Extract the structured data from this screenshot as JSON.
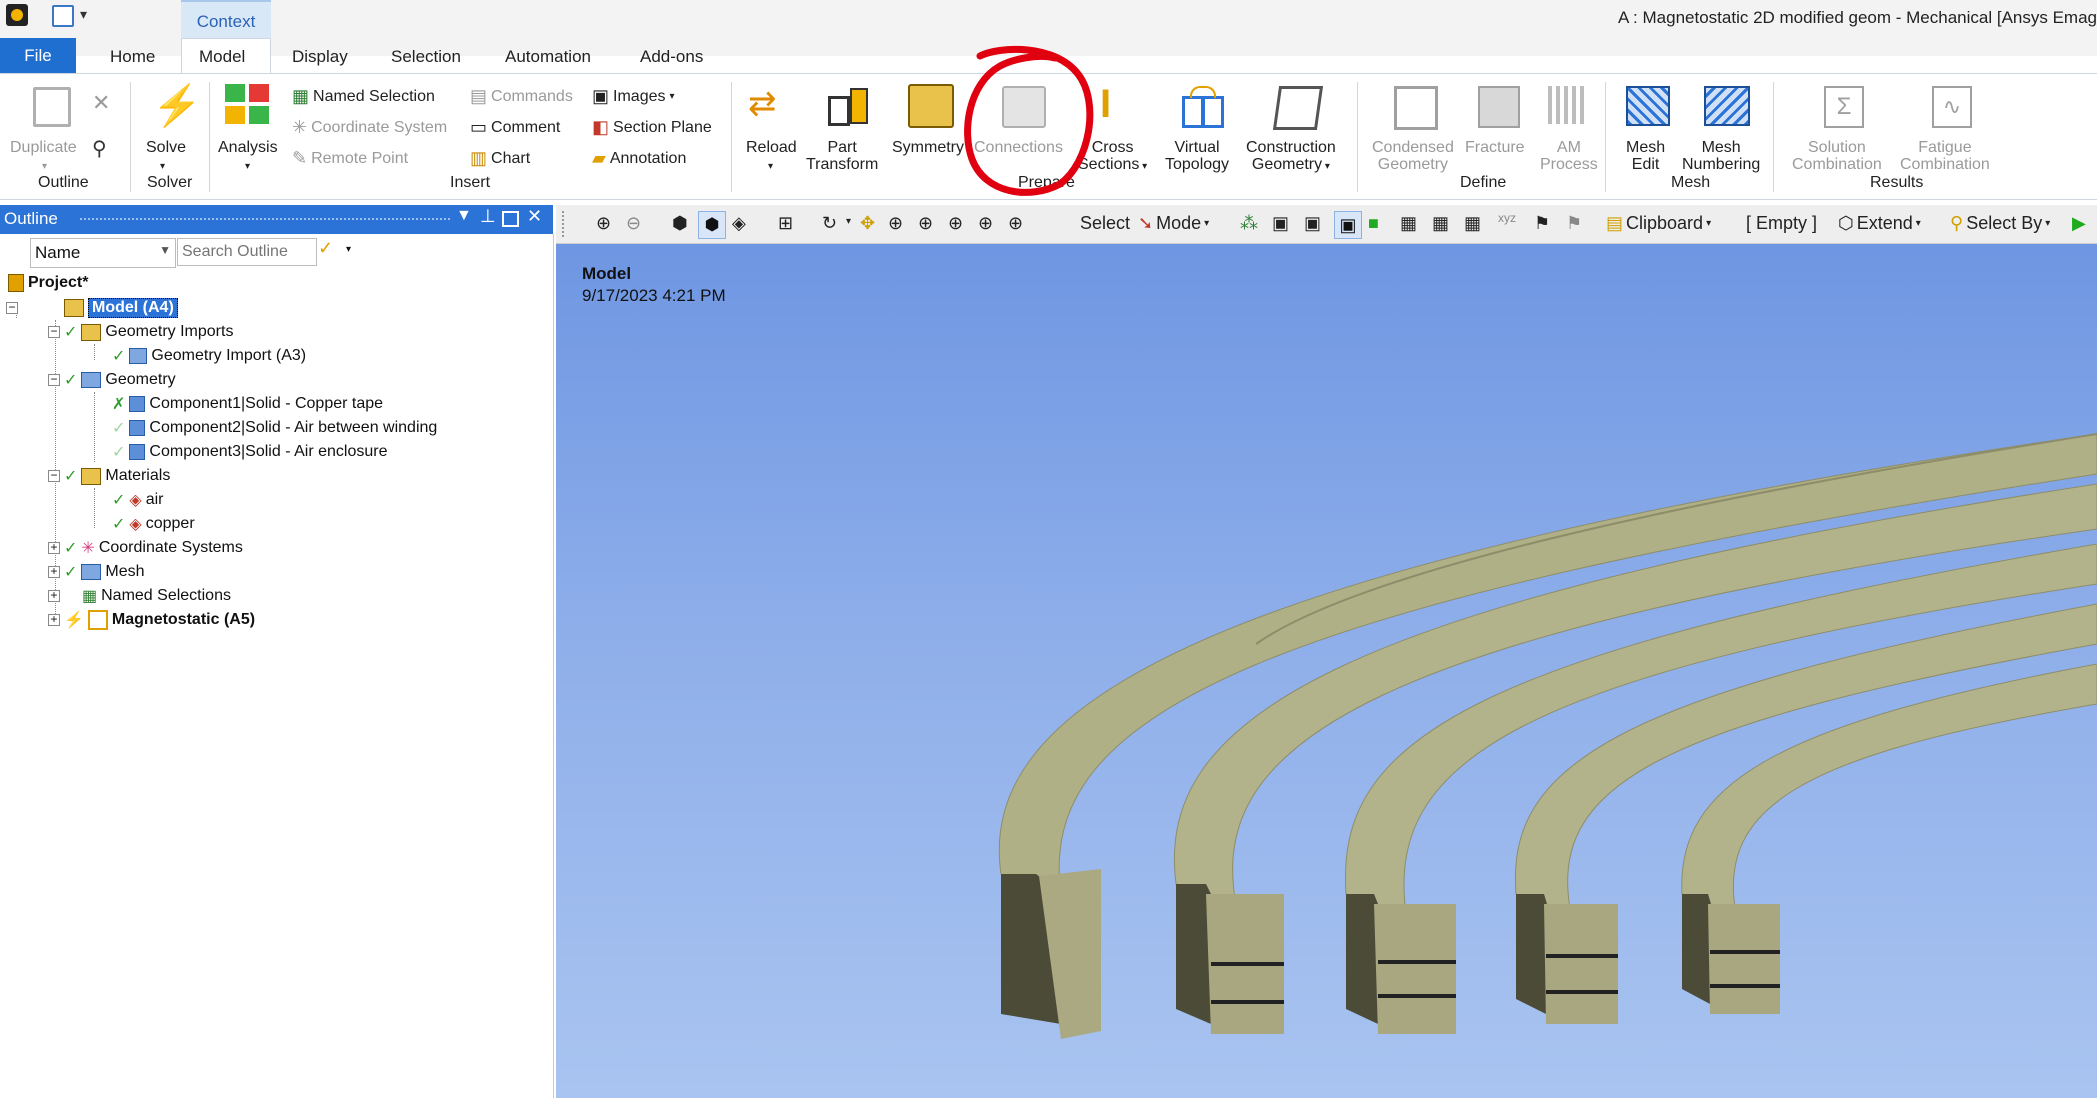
{
  "titlebar": {
    "context_tab": "Context",
    "window_title": "A : Magnetostatic 2D modified geom - Mechanical [Ansys Emag"
  },
  "tabs": [
    "File",
    "Home",
    "Model",
    "Display",
    "Selection",
    "Automation",
    "Add-ons"
  ],
  "ribbon": {
    "outline": {
      "duplicate": "Duplicate",
      "group": "Outline"
    },
    "solver": {
      "solve": "Solve",
      "group": "Solver"
    },
    "insert": {
      "analysis": "Analysis",
      "named_selection": "Named Selection",
      "coordinate_system": "Coordinate System",
      "remote_point": "Remote Point",
      "commands": "Commands",
      "comment": "Comment",
      "chart": "Chart",
      "images": "Images",
      "section_plane": "Section Plane",
      "annotation": "Annotation",
      "group": "Insert"
    },
    "prepare": {
      "reload": "Reload",
      "part_transform_1": "Part",
      "part_transform_2": "Transform",
      "symmetry": "Symmetry",
      "connections": "Connections",
      "cross_sections_1": "Cross",
      "cross_sections_2": "Sections",
      "virtual_topology_1": "Virtual",
      "virtual_topology_2": "Topology",
      "construction_geometry_1": "Construction",
      "construction_geometry_2": "Geometry",
      "group": "Prepare"
    },
    "define": {
      "condensed_geometry_1": "Condensed",
      "condensed_geometry_2": "Geometry",
      "fracture": "Fracture",
      "am_process_1": "AM",
      "am_process_2": "Process",
      "group": "Define"
    },
    "mesh": {
      "mesh_edit_1": "Mesh",
      "mesh_edit_2": "Edit",
      "mesh_numbering_1": "Mesh",
      "mesh_numbering_2": "Numbering",
      "group": "Mesh"
    },
    "results": {
      "solution_combination_1": "Solution",
      "solution_combination_2": "Combination",
      "fatigue_combination_1": "Fatigue",
      "fatigue_combination_2": "Combination",
      "group": "Results"
    }
  },
  "outline": {
    "title": "Outline",
    "filter_field": "Name",
    "search_placeholder": "Search Outline",
    "tree": [
      "Project*",
      "Model (A4)",
      "Geometry Imports",
      "Geometry Import (A3)",
      "Geometry",
      "Component1|Solid - Copper tape",
      "Component2|Solid - Air between winding",
      "Component3|Solid - Air enclosure",
      "Materials",
      "air",
      "copper",
      "Coordinate Systems",
      "Mesh",
      "Named Selections",
      "Magnetostatic (A5)"
    ]
  },
  "viewport_toolbar": {
    "select": "Select",
    "mode": "Mode",
    "clipboard": "Clipboard",
    "empty": "[ Empty ]",
    "extend": "Extend",
    "select_by": "Select By"
  },
  "viewport": {
    "model_label": "Model",
    "timestamp": "9/17/2023 4:21 PM"
  },
  "colors": {
    "accent": "#2b73d6",
    "annotation_circle": "#e0000f",
    "coil_face": "#a9a97e",
    "coil_side": "#4d4d38"
  }
}
